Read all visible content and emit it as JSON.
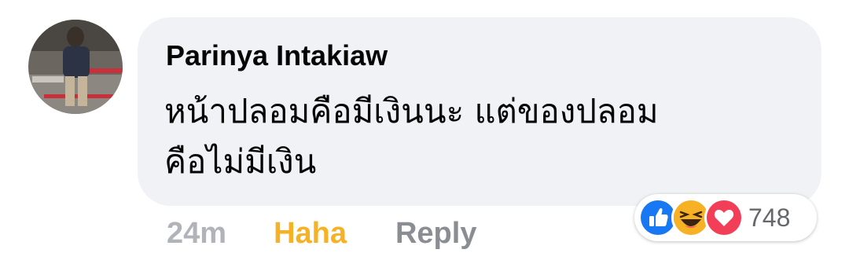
{
  "comment": {
    "author": "Parinya Intakiaw",
    "text_lines": [
      "หน้าปลอมคือมีเงินนะ แต่ของปลอม",
      "คือไม่มีเงิน"
    ],
    "timestamp": "24m",
    "reaction_action_label": "Haha",
    "reply_label": "Reply"
  },
  "reactions": {
    "icons": [
      "like-icon",
      "haha-icon",
      "love-icon"
    ],
    "count": "748"
  },
  "colors": {
    "bubble_bg": "#f0f2f5",
    "haha_accent": "#f7b125",
    "like_blue": "#1877f2",
    "love_red": "#f33e58",
    "muted_text": "#b0b3b8"
  }
}
